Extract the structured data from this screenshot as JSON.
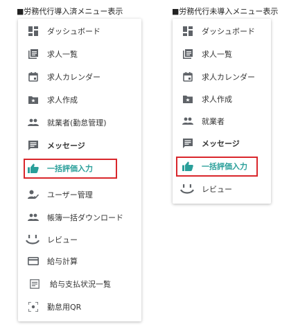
{
  "left_caption": "■労務代行導入済メニュー表示",
  "right_caption": "■労務代行未導入メニュー表示",
  "colors": {
    "accent": "#2a9f9a",
    "highlight_border": "#d9262b",
    "icon": "#5f6368"
  },
  "left_menu": {
    "items": [
      {
        "label": "ダッシュボード",
        "icon": "dashboard-icon"
      },
      {
        "label": "求人一覧",
        "icon": "list-icon"
      },
      {
        "label": "求人カレンダー",
        "icon": "calendar-icon"
      },
      {
        "label": "求人作成",
        "icon": "folder-star-icon"
      },
      {
        "label": "就業者(勤怠管理)",
        "icon": "people-icon"
      },
      {
        "label": "メッセージ",
        "icon": "message-icon"
      },
      {
        "label": "一括評価入力",
        "icon": "thumb-up-icon"
      },
      {
        "label": "ユーザー管理",
        "icon": "user-check-icon"
      },
      {
        "label": "帳簿一括ダウンロード",
        "icon": "people-icon"
      },
      {
        "label": "レビュー",
        "icon": "smile-icon"
      },
      {
        "label": "給与計算",
        "icon": "credit-card-icon"
      },
      {
        "label": "給与支払状況一覧",
        "icon": "document-icon"
      },
      {
        "label": "勤怠用QR",
        "icon": "qr-scan-icon"
      }
    ]
  },
  "right_menu": {
    "items": [
      {
        "label": "ダッシュボード",
        "icon": "dashboard-icon"
      },
      {
        "label": "求人一覧",
        "icon": "list-icon"
      },
      {
        "label": "求人カレンダー",
        "icon": "calendar-icon"
      },
      {
        "label": "求人作成",
        "icon": "folder-star-icon"
      },
      {
        "label": "就業者",
        "icon": "people-icon"
      },
      {
        "label": "メッセージ",
        "icon": "message-icon"
      },
      {
        "label": "一括評価入力",
        "icon": "thumb-up-icon"
      },
      {
        "label": "レビュー",
        "icon": "smile-icon"
      }
    ]
  }
}
